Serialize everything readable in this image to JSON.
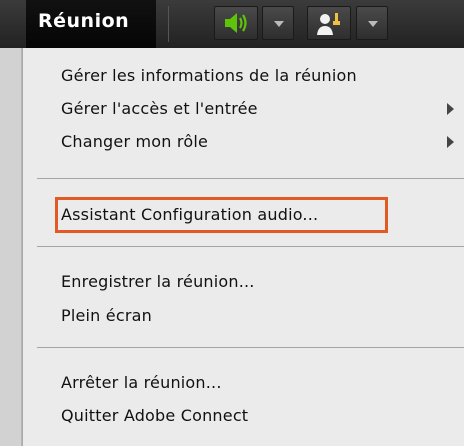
{
  "toolbar": {
    "menu_title": "Réunion",
    "speaker_icon": "speaker-icon",
    "speaker_color": "#5ec40a",
    "user_icon": "raise-hand-icon"
  },
  "menu": {
    "highlight_color": "#e05a22",
    "groups": [
      {
        "items": [
          {
            "label": "Gérer les informations de la réunion",
            "has_submenu": false
          },
          {
            "label": "Gérer l'accès et l'entrée",
            "has_submenu": true
          },
          {
            "label": "Changer mon rôle",
            "has_submenu": true
          }
        ]
      },
      {
        "items": [
          {
            "label": "Assistant Configuration audio...",
            "has_submenu": false,
            "highlighted": true
          }
        ]
      },
      {
        "items": [
          {
            "label": "Enregistrer la réunion...",
            "has_submenu": false
          },
          {
            "label": "Plein écran",
            "has_submenu": false
          }
        ]
      },
      {
        "items": [
          {
            "label": "Arrêter la réunion...",
            "has_submenu": false
          },
          {
            "label": "Quitter Adobe Connect",
            "has_submenu": false
          }
        ]
      }
    ]
  }
}
